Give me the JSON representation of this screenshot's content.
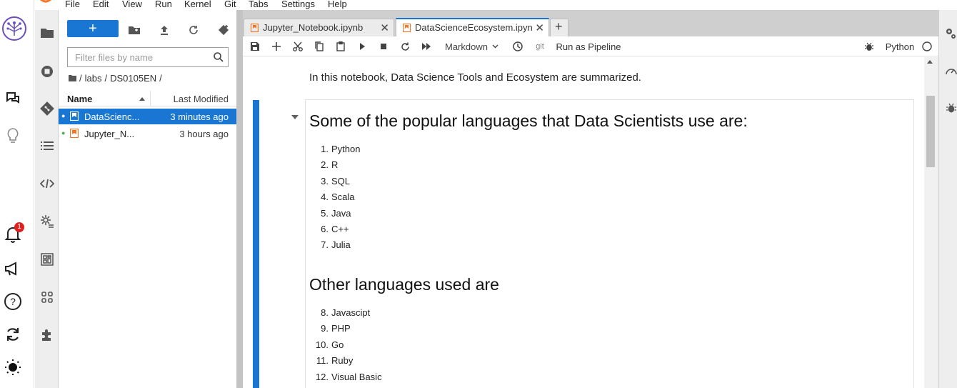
{
  "menu": {
    "items": [
      "File",
      "Edit",
      "View",
      "Run",
      "Kernel",
      "Git",
      "Tabs",
      "Settings",
      "Help"
    ]
  },
  "outer_strip": {
    "notification_count": "1",
    "icons": [
      "skills-network-logo-icon",
      "chat-icon",
      "lightbulb-icon",
      "bell-icon",
      "megaphone-icon",
      "help-icon",
      "sync-icon",
      "brightness-icon"
    ]
  },
  "activity_bar": {
    "icons": [
      "folder-icon",
      "running-icon",
      "git-icon",
      "toc-icon",
      "code-snippet-icon",
      "property-inspector-icon",
      "dashboard-icon",
      "widgets-icon",
      "extension-icon"
    ]
  },
  "file_browser": {
    "filter_placeholder": "Filter files by name",
    "breadcrumb": [
      "/",
      "labs",
      "/",
      "DS0105EN",
      "/"
    ],
    "columns": {
      "name": "Name",
      "modified": "Last Modified"
    },
    "files": [
      {
        "name": "DataScienc...",
        "modified": "3 minutes ago",
        "selected": true
      },
      {
        "name": "Jupyter_N...",
        "modified": "3 hours ago",
        "selected": false
      }
    ]
  },
  "tabs": [
    {
      "label": "Jupyter_Notebook.ipynb",
      "close": "✕",
      "active": false
    },
    {
      "label": "DataScienceEcosystem.ipyn",
      "close": "✕",
      "active": true
    }
  ],
  "add_tab_label": "+",
  "toolbar": {
    "cell_type": "Markdown",
    "git_label": "git",
    "pipeline_label": "Run as Pipeline",
    "kernel_name": "Python"
  },
  "notebook": {
    "intro": "In this notebook, Data Science Tools and Ecosystem are summarized.",
    "heading1": "Some of the popular languages that Data Scientists use are:",
    "list1": [
      {
        "num": "1.",
        "text": "Python"
      },
      {
        "num": "2.",
        "text": "R"
      },
      {
        "num": "3.",
        "text": "SQL"
      },
      {
        "num": "4.",
        "text": "Scala"
      },
      {
        "num": "5.",
        "text": "Java"
      },
      {
        "num": "6.",
        "text": "C++"
      },
      {
        "num": "7.",
        "text": "Julia"
      }
    ],
    "heading2": "Other languages used are",
    "list2": [
      {
        "num": "8.",
        "text": "Javascipt"
      },
      {
        "num": "9.",
        "text": "PHP"
      },
      {
        "num": "10.",
        "text": "Go"
      },
      {
        "num": "11.",
        "text": "Ruby"
      },
      {
        "num": "12.",
        "text": "Visual Basic"
      }
    ]
  },
  "colors": {
    "accent": "#1976d2",
    "notebook_tab_icon": "#f37626",
    "notification": "#e02020"
  }
}
